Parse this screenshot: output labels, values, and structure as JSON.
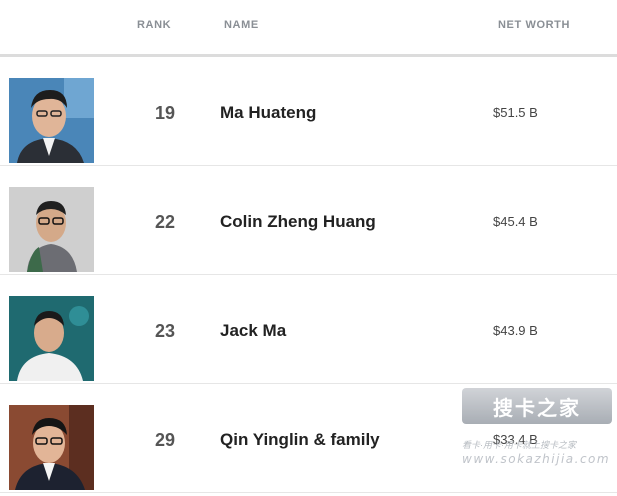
{
  "header": {
    "rank_label": "RANK",
    "name_label": "NAME",
    "networth_label": "NET WORTH"
  },
  "rows": [
    {
      "rank": "19",
      "name": "Ma Huateng",
      "net_worth": "$51.5 B"
    },
    {
      "rank": "22",
      "name": "Colin Zheng Huang",
      "net_worth": "$45.4 B"
    },
    {
      "rank": "23",
      "name": "Jack Ma",
      "net_worth": "$43.9 B"
    },
    {
      "rank": "29",
      "name": "Qin Yinglin & family",
      "net_worth": "$33.4 B"
    }
  ],
  "watermark": {
    "logo_text": "搜卡之家",
    "tagline": "看卡·用卡·用卡就上搜卡之家",
    "url": "www.sokazhijia.com"
  }
}
